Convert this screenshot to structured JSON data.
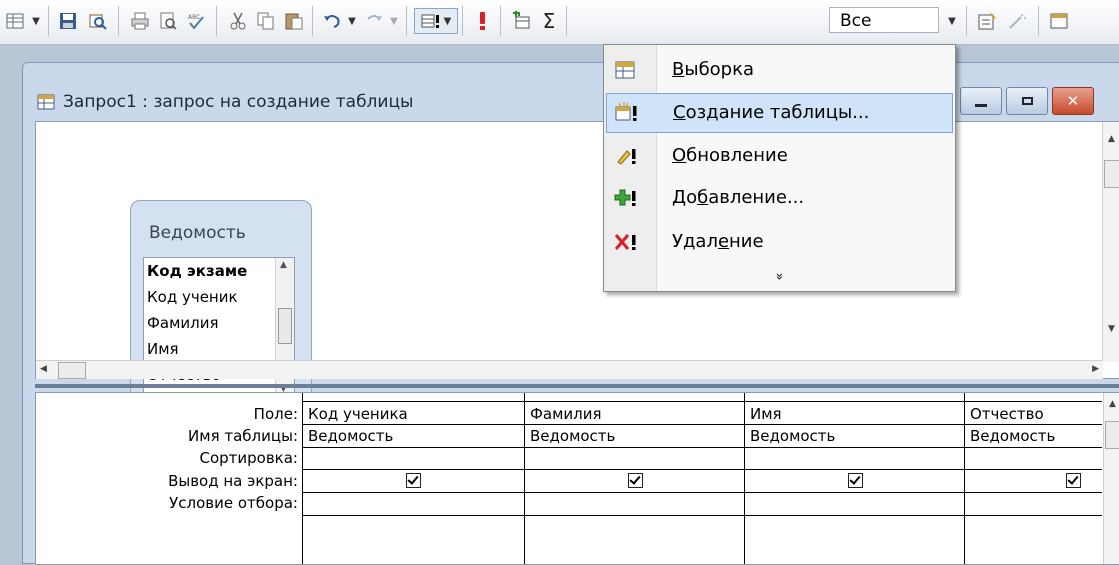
{
  "toolbar": {
    "combo_value": "Все",
    "combo_arrow": "▾",
    "sigma": "Σ",
    "icons": [
      "view-icon",
      "save-icon",
      "search-icon",
      "print-icon",
      "print-preview-icon",
      "spelling-icon",
      "cut-icon",
      "copy-icon",
      "paste-icon",
      "undo-icon",
      "redo-icon",
      "query-type-icon",
      "run-icon",
      "show-table-icon",
      "totals-icon",
      "properties-icon",
      "builder-icon",
      "database-window-icon"
    ]
  },
  "window": {
    "title": "Запрос1 : запрос на создание таблицы"
  },
  "table_box": {
    "title": "Ведомость",
    "fields": [
      "Код экзаме",
      "Код ученик",
      "Фамилия",
      "Имя",
      "Отчество"
    ]
  },
  "grid": {
    "row_labels": [
      "Поле:",
      "Имя таблицы:",
      "Сортировка:",
      "Вывод на экран:",
      "Условие отбора:"
    ],
    "columns": [
      {
        "field": "Код ученика",
        "table": "Ведомость",
        "show": true
      },
      {
        "field": "Фамилия",
        "table": "Ведомость",
        "show": true
      },
      {
        "field": "Имя",
        "table": "Ведомость",
        "show": true
      },
      {
        "field": "Отчество",
        "table": "Ведомость",
        "show": true
      }
    ]
  },
  "menu": {
    "items": [
      {
        "pre": "",
        "accel": "В",
        "post": "ыборка",
        "icon": "select-query-icon"
      },
      {
        "pre": "",
        "accel": "С",
        "post": "оздание таблицы...",
        "icon": "make-table-query-icon",
        "selected": true
      },
      {
        "pre": "",
        "accel": "О",
        "post": "бновление",
        "icon": "update-query-icon"
      },
      {
        "pre": "До",
        "accel": "б",
        "post": "авление...",
        "icon": "append-query-icon"
      },
      {
        "pre": "Удал",
        "accel": "е",
        "post": "ние",
        "icon": "delete-query-icon"
      }
    ],
    "more": "»"
  },
  "colors": {
    "selection": "#cfe4f8",
    "selection_border": "#7aa7d8",
    "window_frame": "#c9d8ea",
    "close_red": "#c74a2c"
  }
}
